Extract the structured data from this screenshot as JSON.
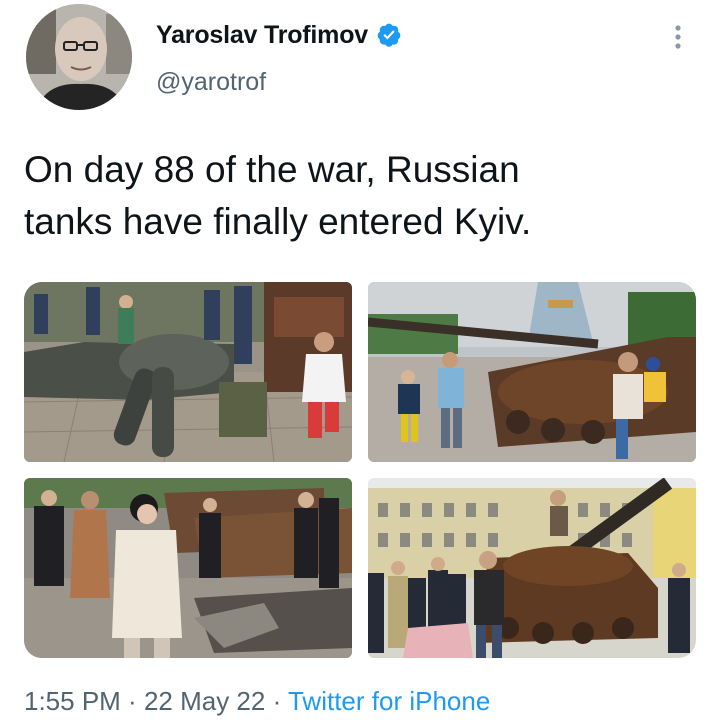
{
  "author": {
    "name": "Yaroslav Trofimov",
    "handle": "@yarotrof",
    "verified": true
  },
  "tweet": {
    "text": "On day 88 of the war, Russian\ntanks have finally entered Kyiv."
  },
  "meta": {
    "time": "1:55 PM",
    "separator": " · ",
    "date": "22 May 22",
    "source": "Twitter for iPhone"
  },
  "colors": {
    "accent": "#1d9bf0",
    "text": "#0f1419",
    "secondary": "#536471"
  },
  "icons": [
    "verified-badge-icon",
    "more-options-icon"
  ]
}
